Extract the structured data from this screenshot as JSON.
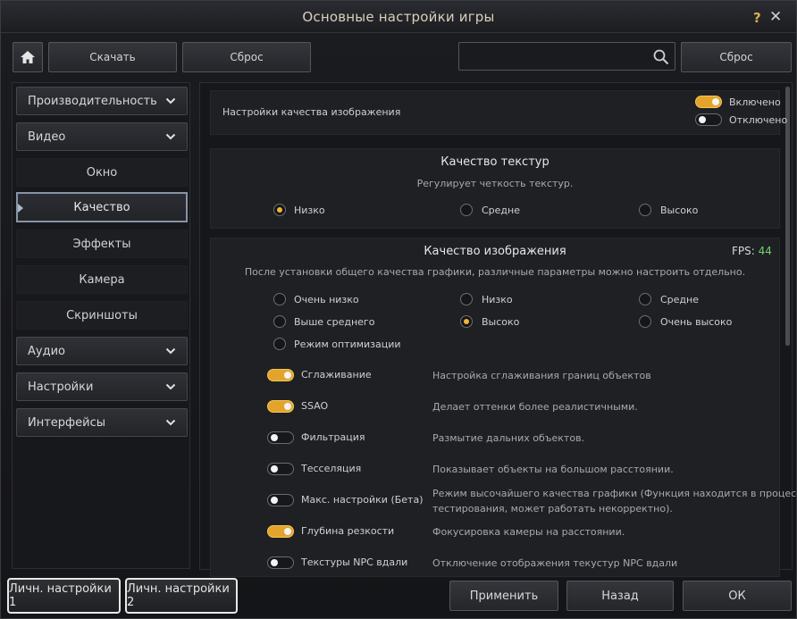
{
  "window": {
    "title": "Основные настройки игры"
  },
  "toolbar": {
    "download": "Скачать",
    "reset": "Сброс",
    "search_value": "",
    "reset_right": "Сброс"
  },
  "sidebar": {
    "categories": [
      {
        "label": "Производительность"
      },
      {
        "label": "Видео"
      },
      {
        "label": "Аудио"
      },
      {
        "label": "Настройки"
      },
      {
        "label": "Интерфейсы"
      }
    ],
    "video_subitems": [
      {
        "label": "Окно"
      },
      {
        "label": "Качество"
      },
      {
        "label": "Эффекты"
      },
      {
        "label": "Камера"
      },
      {
        "label": "Скриншоты"
      }
    ],
    "active_item": "Качество"
  },
  "image_settings": {
    "label": "Настройки качества изображения",
    "on_label": "Включено",
    "off_label": "Отключено",
    "value": "on"
  },
  "texture": {
    "title": "Качество текстур",
    "subtitle": "Регулирует четкость текстур.",
    "options": [
      "Низко",
      "Средне",
      "Высоко"
    ],
    "selected": "Низко"
  },
  "image_quality": {
    "title": "Качество изображения",
    "fps_label": "FPS:",
    "fps_value": "44",
    "subtitle": "После установки общего качества графики, различные параметры можно настроить отдельно.",
    "options": [
      "Очень низко",
      "Низко",
      "Средне",
      "Выше среднего",
      "Высоко",
      "Очень высоко",
      "Режим оптимизации"
    ],
    "selected": "Высоко",
    "toggles": [
      {
        "name": "Сглаживание",
        "desc": "Настройка сглаживания границ объектов",
        "on": true
      },
      {
        "name": "SSAO",
        "desc": "Делает оттенки более реалистичными.",
        "on": true
      },
      {
        "name": "Фильтрация",
        "desc": "Размытие дальних объектов.",
        "on": false
      },
      {
        "name": "Тесселяция",
        "desc": "Показывает объекты на большом расстоянии.",
        "on": false
      },
      {
        "name": "Макс. настройки (Бета)",
        "desc": "Режим высочайшего качества графики (Функция находится в процессе",
        "desc2": "тестирования, может работать некорректно).",
        "on": false
      },
      {
        "name": "Глубина резкости",
        "desc": "Фокусировка камеры на расстоянии.",
        "on": true
      },
      {
        "name": "Текстуры NPC вдали",
        "desc": "Отключение отображения текустур NPC вдали",
        "on": false
      }
    ]
  },
  "footer": {
    "preset1": "Личн. настройки 1",
    "preset2": "Личн. настройки 2",
    "apply": "Применить",
    "back": "Назад",
    "ok": "ОК"
  },
  "colors": {
    "accent": "#e3a42b",
    "fps": "#6fd16f",
    "active_border": "#8794a6"
  }
}
